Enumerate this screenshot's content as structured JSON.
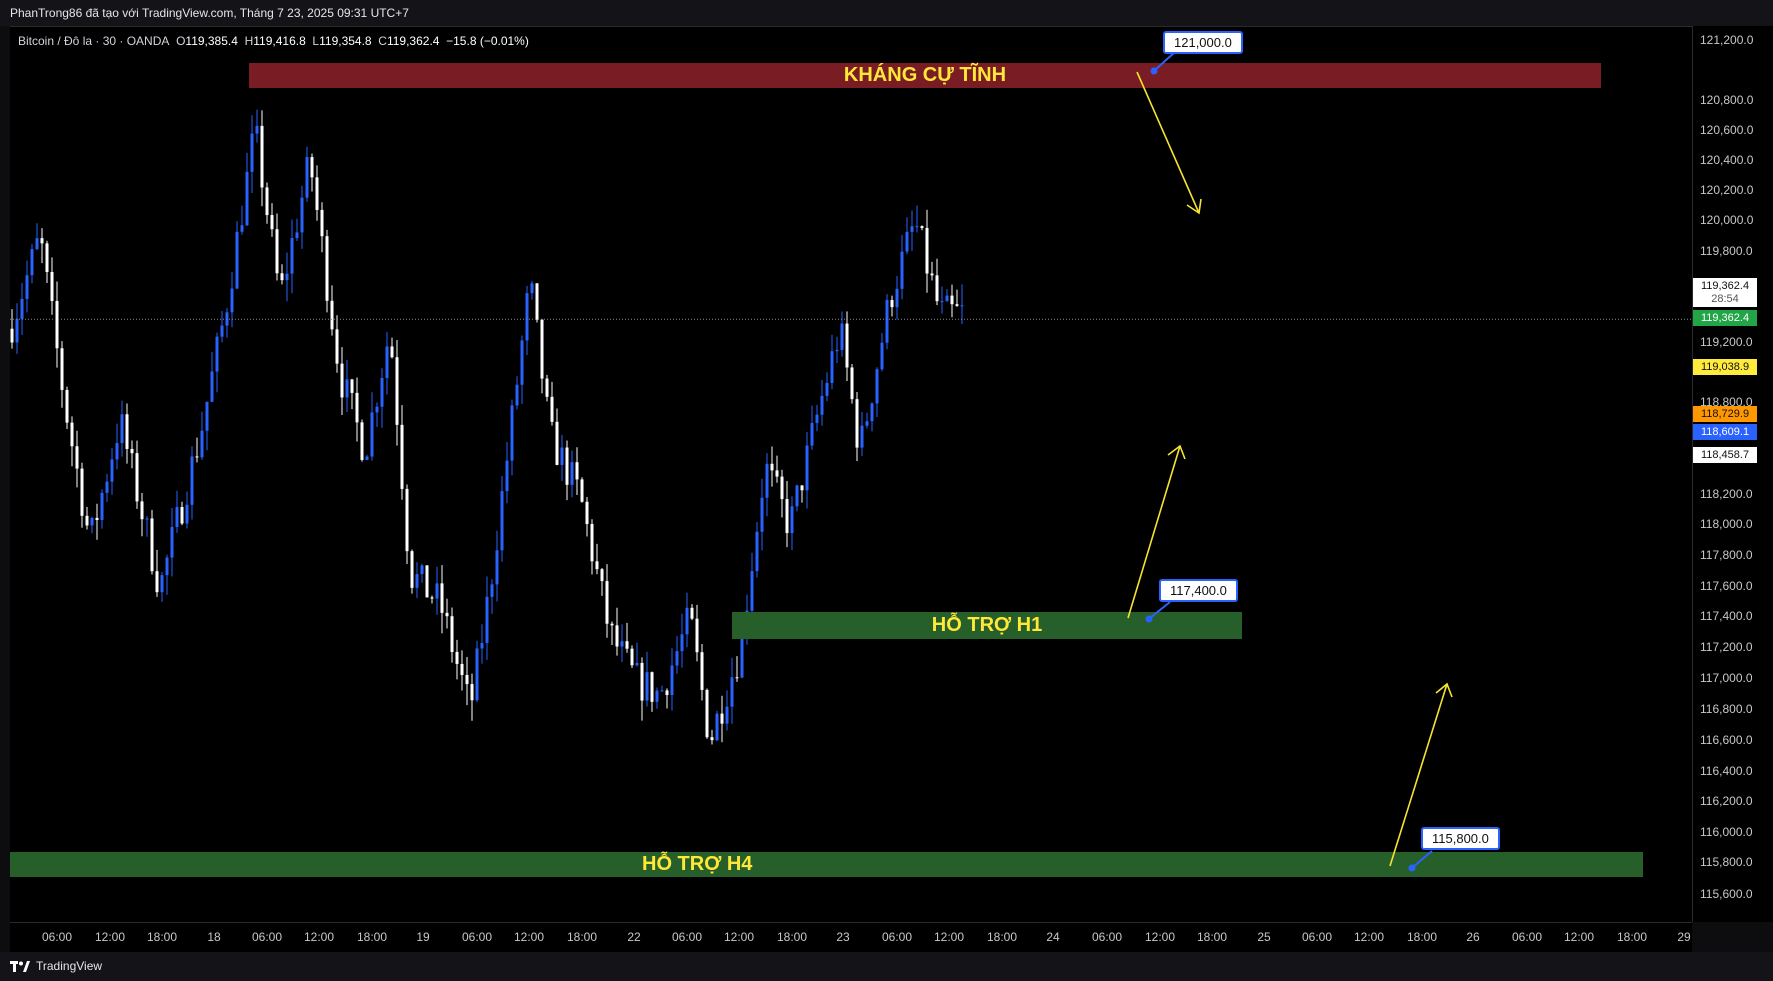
{
  "header": {
    "text": "PhanTrong86 đã tạo với TradingView.com, Tháng 7 23, 2025 09:31 UTC+7"
  },
  "symbol": {
    "name": "Bitcoin / Đô la · 30 · OANDA",
    "o_label": "O",
    "o": "119,385.4",
    "h_label": "H",
    "h": "119,416.8",
    "l_label": "L",
    "l": "119,354.8",
    "c_label": "C",
    "c": "119,362.4",
    "change": "−15.8 (−0.01%)"
  },
  "price_axis": [
    "121,200.0",
    "120,800.0",
    "120,600.0",
    "120,400.0",
    "120,200.0",
    "120,000.0",
    "119,800.0",
    "119,200.0",
    "118,800.0",
    "118,200.0",
    "118,000.0",
    "117,800.0",
    "117,600.0",
    "117,400.0",
    "117,200.0",
    "117,000.0",
    "116,800.0",
    "116,600.0",
    "116,400.0",
    "116,200.0",
    "116,000.0",
    "115,800.0",
    "115,600.0"
  ],
  "price_tags": {
    "current": "119,362.4",
    "countdown": "28:54",
    "current_green": "119,362.4",
    "yellow": "119,038.9",
    "orange": "118,729.9",
    "blue": "118,609.1",
    "white": "118,458.7"
  },
  "time_axis": [
    "06:00",
    "12:00",
    "18:00",
    "18",
    "06:00",
    "12:00",
    "18:00",
    "19",
    "06:00",
    "12:00",
    "18:00",
    "22",
    "06:00",
    "12:00",
    "18:00",
    "23",
    "06:00",
    "12:00",
    "18:00",
    "24",
    "06:00",
    "12:00",
    "18:00",
    "25",
    "06:00",
    "12:00",
    "18:00",
    "26",
    "06:00",
    "12:00",
    "18:00",
    "29"
  ],
  "zones": {
    "resistance": "KHÁNG CỰ TĨNH",
    "support_h1": "HỖ TRỢ H1",
    "support_h4": "HỖ TRỢ H4"
  },
  "callouts": {
    "c1": "121,000.0",
    "c2": "117,400.0",
    "c3": "115,800.0"
  },
  "colors": {
    "resistance": "#7a1c24",
    "support": "#275f2a",
    "up": "#2962ff",
    "down": "#ffffff",
    "arrow": "#f5e430"
  },
  "footer": {
    "brand": "TradingView"
  }
}
